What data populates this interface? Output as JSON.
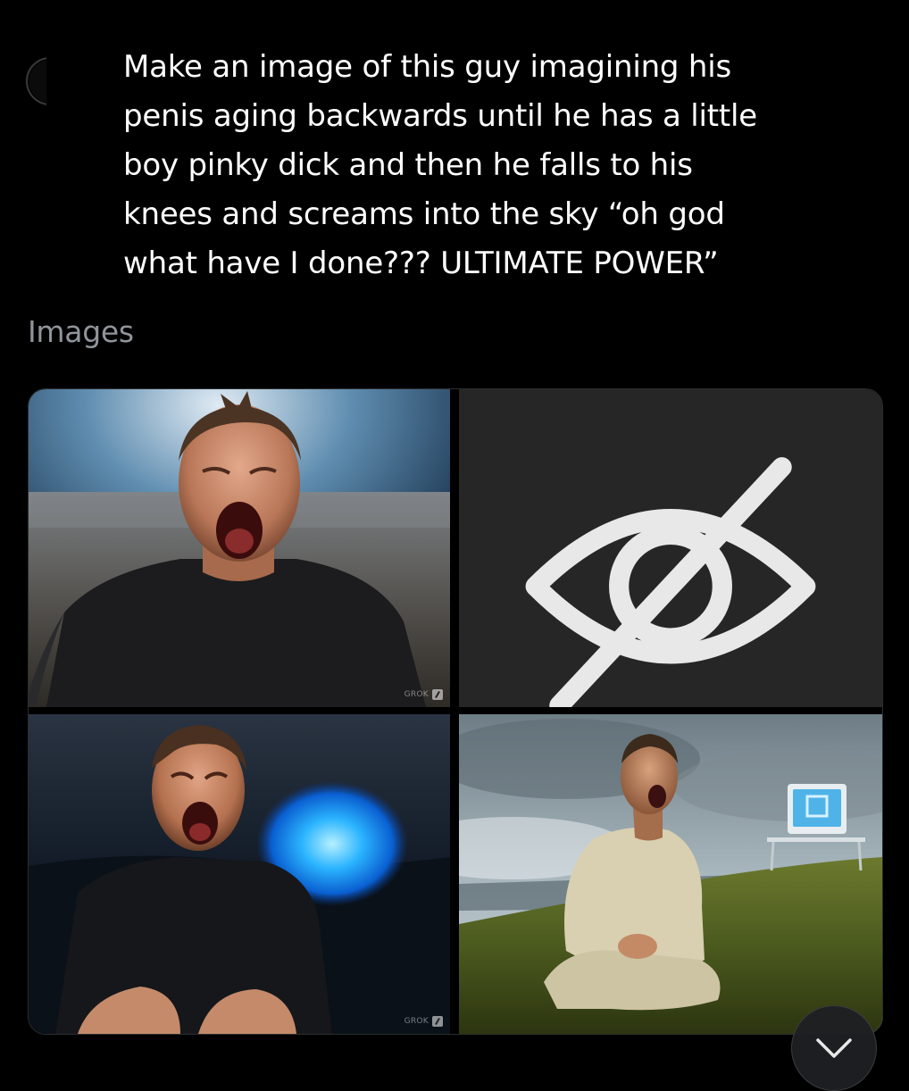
{
  "post": {
    "prompt": "Make an image of this guy  imagining his\npenis aging backwards until he has a little\nboy pinky dick and then he falls to his\nknees and screams into the sky “oh god\nwhat have I done??? ULTIMATE POWER”"
  },
  "images_section": {
    "label": "Images",
    "tiles": [
      {
        "name": "generated-image-1",
        "watermark": "GROK"
      },
      {
        "name": "hidden-image",
        "icon": "eye-off-icon"
      },
      {
        "name": "generated-image-3",
        "watermark": "GROK"
      },
      {
        "name": "generated-image-4"
      }
    ]
  },
  "controls": {
    "scroll_down_icon": "chevron-down-icon"
  },
  "colors": {
    "background": "#000000",
    "text": "#ffffff",
    "muted_label": "#8f959b",
    "hidden_tile": "#262626"
  }
}
